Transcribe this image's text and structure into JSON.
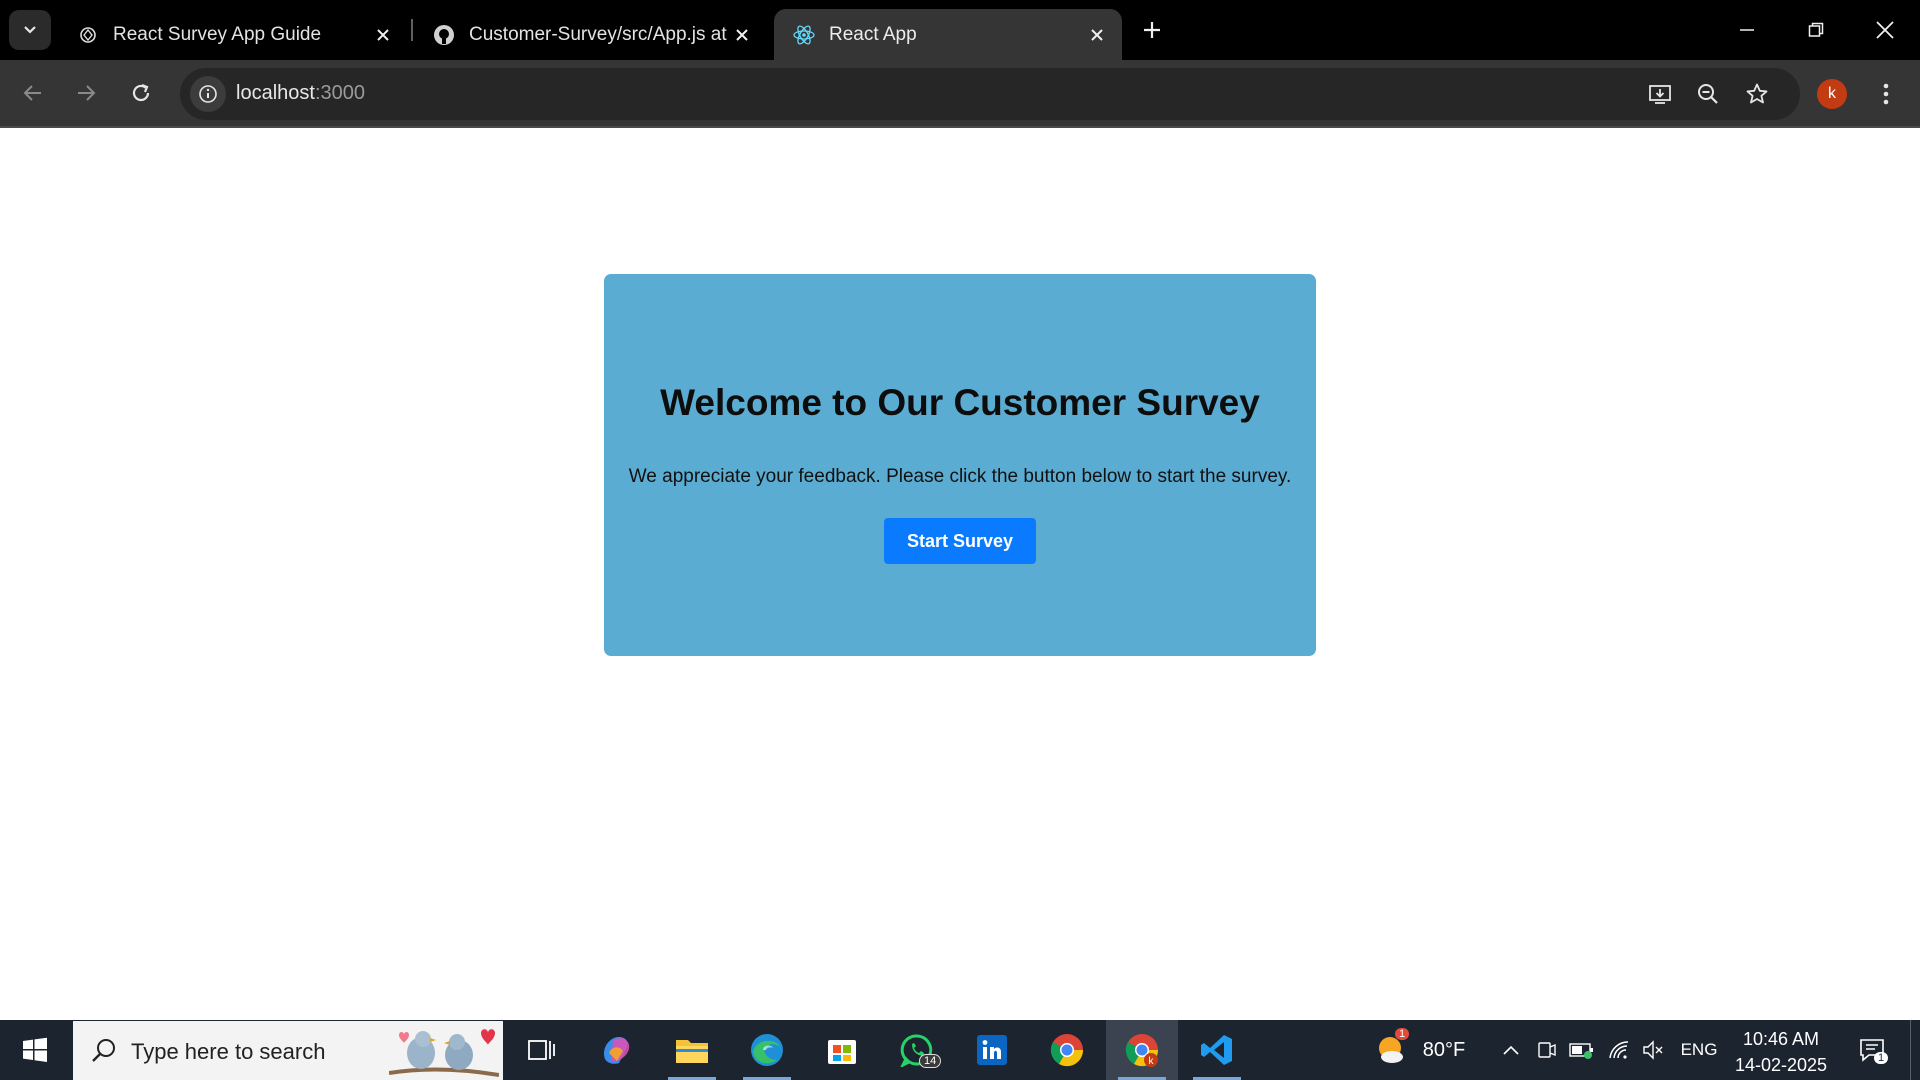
{
  "browser": {
    "tabs": [
      {
        "title": "React Survey App Guide",
        "icon": "openai-icon",
        "active": false
      },
      {
        "title": "Customer-Survey/src/App.js at main",
        "icon": "github-icon",
        "active": false
      },
      {
        "title": "React App",
        "icon": "react-icon",
        "active": true
      }
    ],
    "address": {
      "host": "localhost",
      "port": ":3000"
    },
    "profile_initial": "k",
    "accent_profile": "#c23b12"
  },
  "page": {
    "heading": "Welcome to Our Customer Survey",
    "description": "We appreciate your feedback. Please click the button below to start the survey.",
    "start_button": "Start Survey",
    "card_color": "#5bacd2",
    "button_color": "#0a7bff"
  },
  "taskbar": {
    "search_placeholder": "Type here to search",
    "whatsapp_badge": "14",
    "weather": {
      "temp": "80°F",
      "badge": "1"
    },
    "language": "ENG",
    "time": "10:46 AM",
    "date": "14-02-2025",
    "notifications": "1"
  }
}
